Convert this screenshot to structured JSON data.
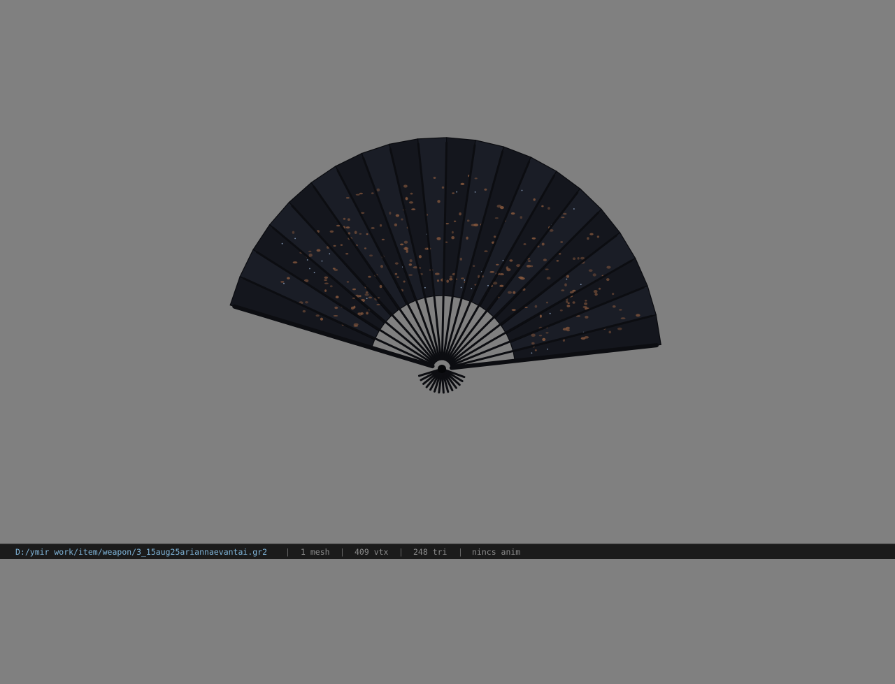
{
  "viewer": {
    "background_color": "#808080",
    "model": {
      "object": "folding fan",
      "colors": {
        "leaf": "#14161d",
        "leaf_edge": "#0a0b0f",
        "rib": "#0c0d11",
        "pattern": "#8a5a3e",
        "sparkle": "#9fb6d6"
      }
    }
  },
  "statusbar": {
    "file_path": "D:/ymir work/item/weapon/3_15aug25ariannaevantai.gr2",
    "separator": "|",
    "mesh_count": "1 mesh",
    "vertex_count": "409 vtx",
    "triangle_count": "248 tri",
    "anim_status": "nincs anim",
    "colors": {
      "background": "#1b1b1b",
      "path_text": "#7fb4d8",
      "text": "#8c8c8c"
    }
  }
}
